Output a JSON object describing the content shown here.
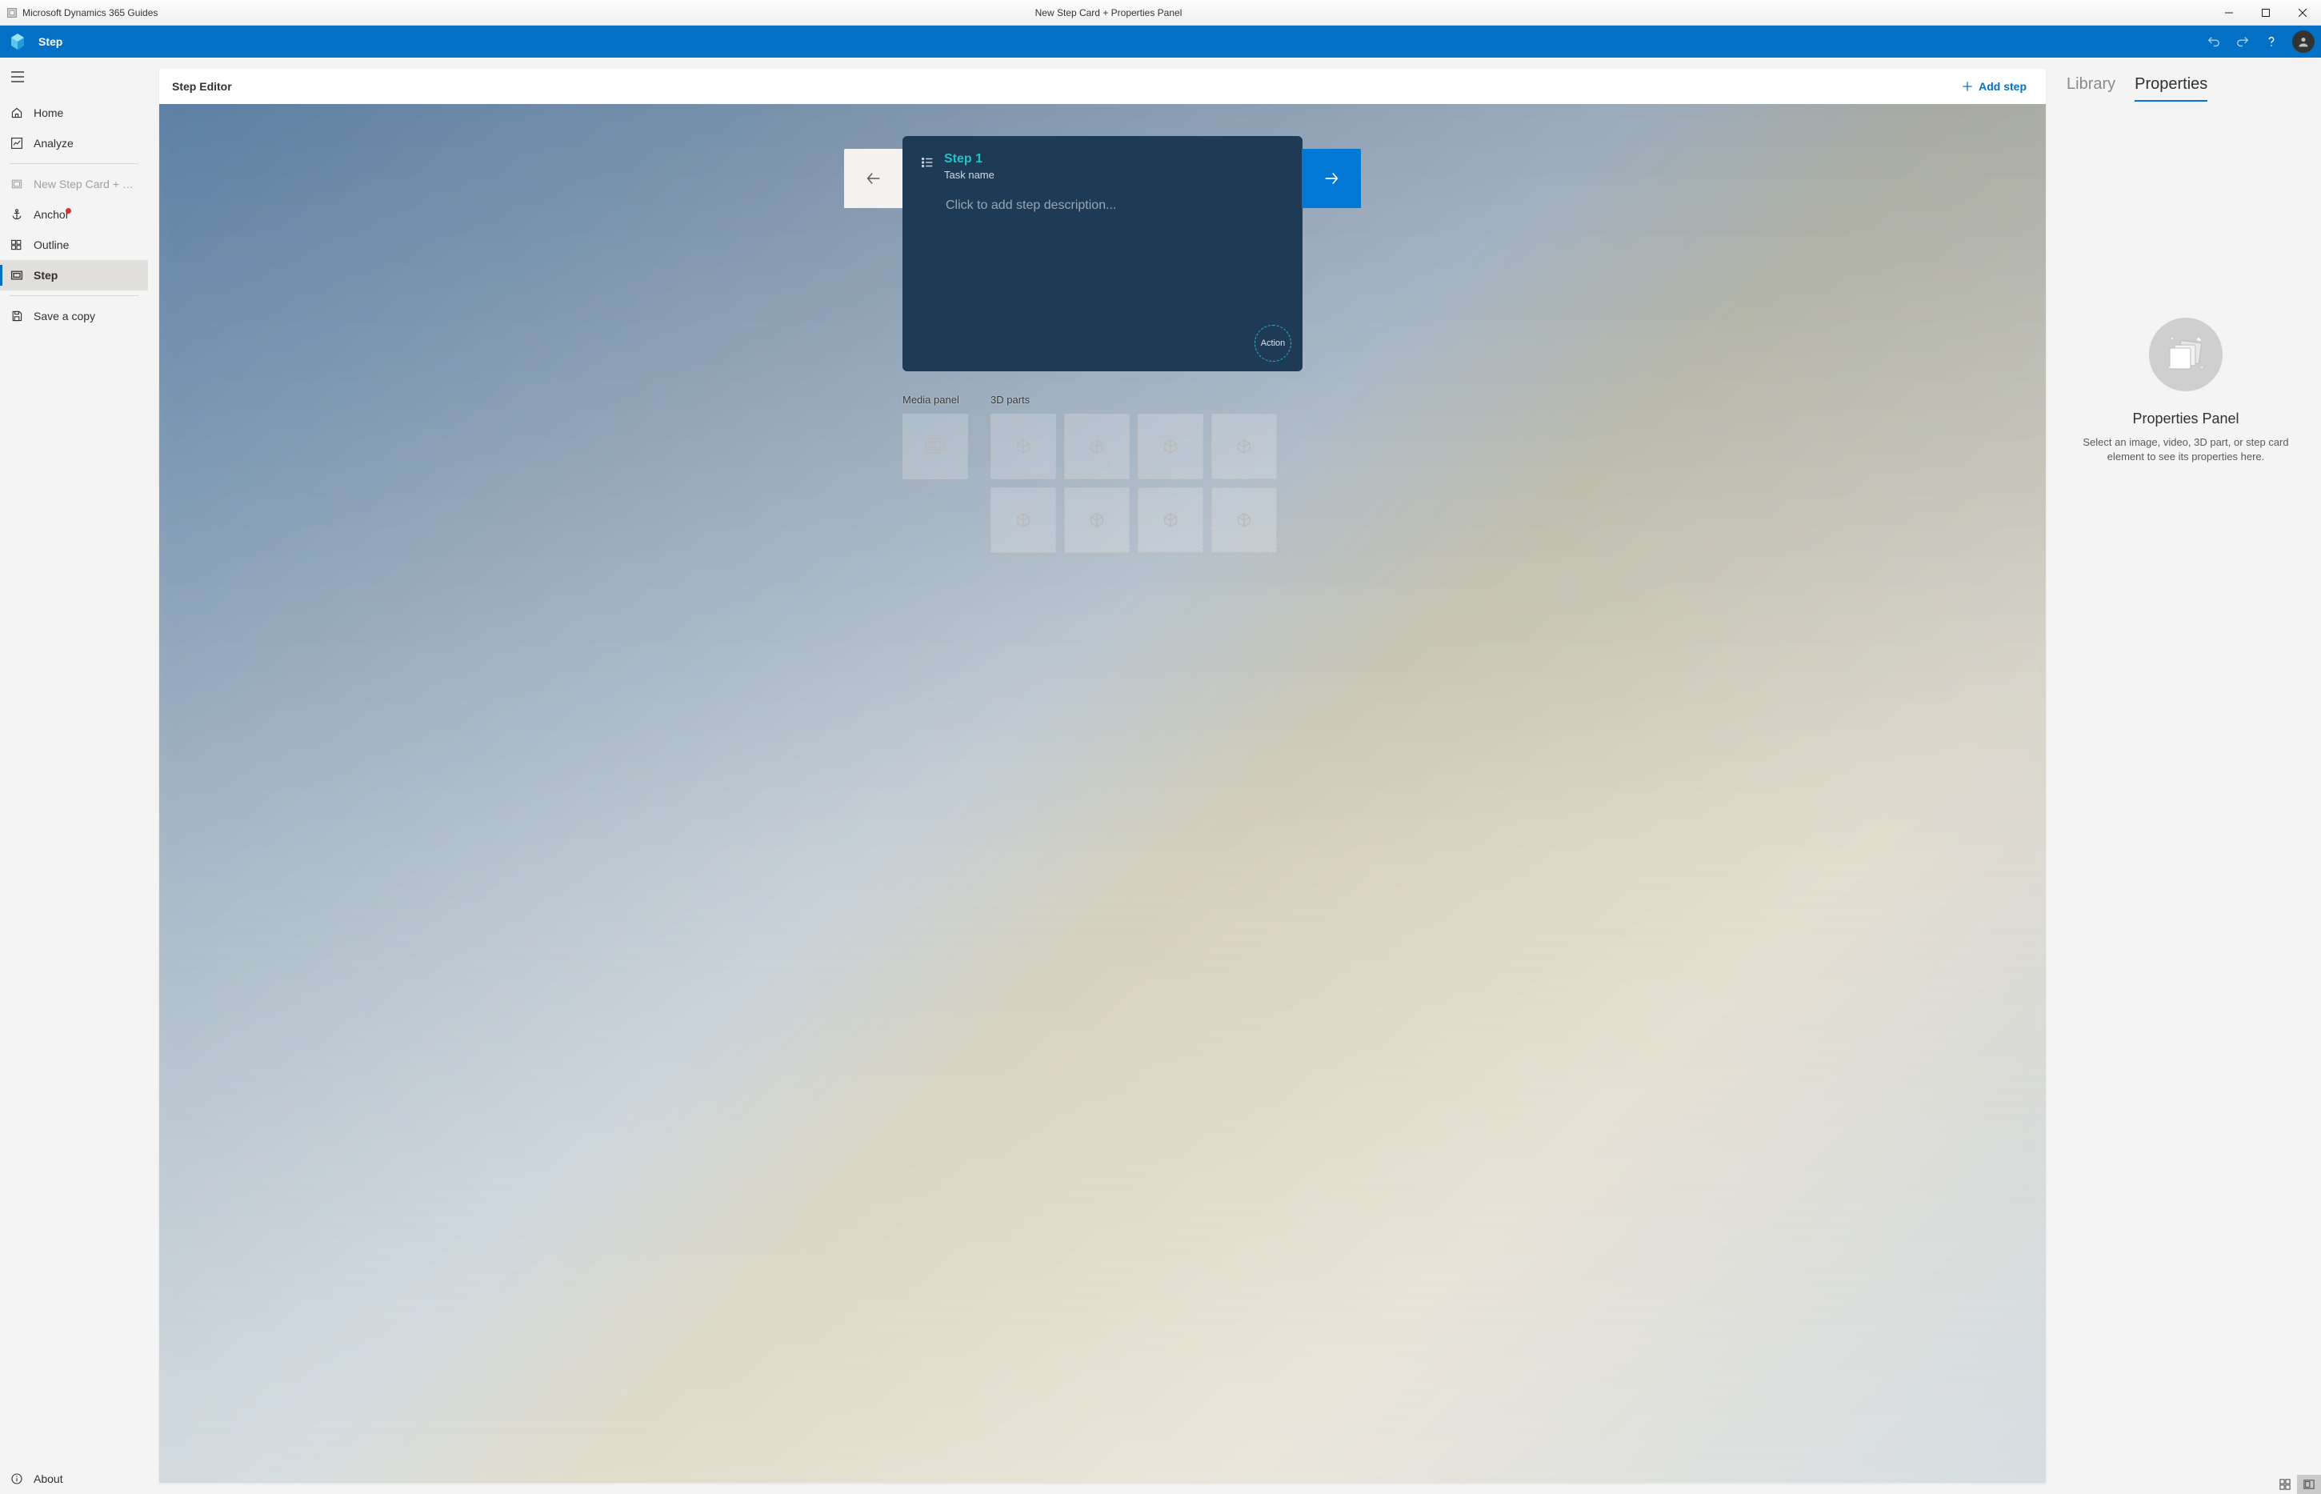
{
  "titlebar": {
    "app_name": "Microsoft Dynamics 365 Guides",
    "document_title": "New Step Card + Properties Panel"
  },
  "commandbar": {
    "title": "Step"
  },
  "sidebar": {
    "nav": {
      "home": "Home",
      "analyze": "Analyze"
    },
    "doc": {
      "current": "New Step Card + Pr..."
    },
    "project": {
      "anchor": "Anchor",
      "outline": "Outline",
      "step": "Step"
    },
    "actions": {
      "save_copy": "Save a copy"
    },
    "footer": {
      "about": "About"
    }
  },
  "editor": {
    "header_title": "Step Editor",
    "add_step": "Add step",
    "card": {
      "title": "Step 1",
      "subtitle": "Task name",
      "placeholder": "Click to add step description...",
      "action_label": "Action"
    },
    "panels": {
      "media_label": "Media panel",
      "parts_label": "3D parts"
    }
  },
  "right": {
    "tabs": {
      "library": "Library",
      "properties": "Properties"
    },
    "properties": {
      "title": "Properties Panel",
      "description": "Select an image, video, 3D part, or step card element to see its properties here."
    }
  }
}
